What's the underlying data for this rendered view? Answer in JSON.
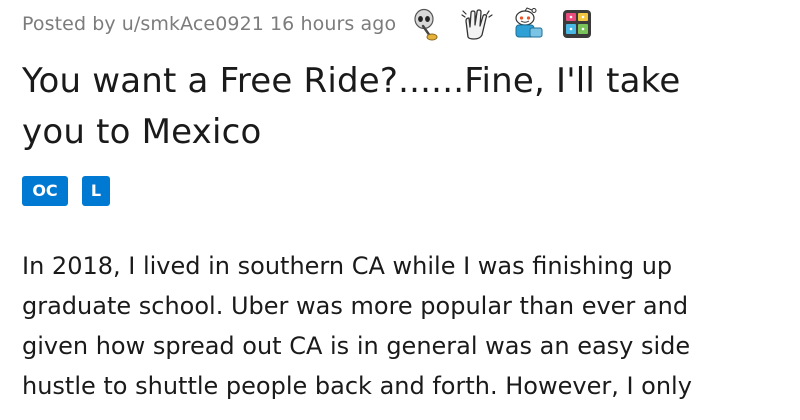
{
  "post": {
    "meta": {
      "prefix": "Posted by",
      "author": "u/smkAce0921",
      "time": "16 hours ago"
    },
    "awards": [
      {
        "icon": "skull-award-icon",
        "color": "#bfbfbf"
      },
      {
        "icon": "clapping-hands-award-icon",
        "color": "#d9d9d9"
      },
      {
        "icon": "snoo-award-icon",
        "color": "#4f9fd6"
      },
      {
        "icon": "calendar-award-icon",
        "color": "#e8c54a"
      }
    ],
    "title_lines": [
      "You want a Free Ride?......Fine, I'll take",
      "you to Mexico"
    ],
    "flairs": [
      {
        "label": "OC",
        "color": "#0079d3"
      },
      {
        "label": "L",
        "color": "#0079d3"
      }
    ],
    "body_lines": [
      "In 2018, I lived in southern CA while I was finishing up",
      "graduate school. Uber was more popular than ever and",
      "given how spread out CA is in general was an easy side",
      "hustle to shuttle people back and forth. However, I only"
    ]
  }
}
